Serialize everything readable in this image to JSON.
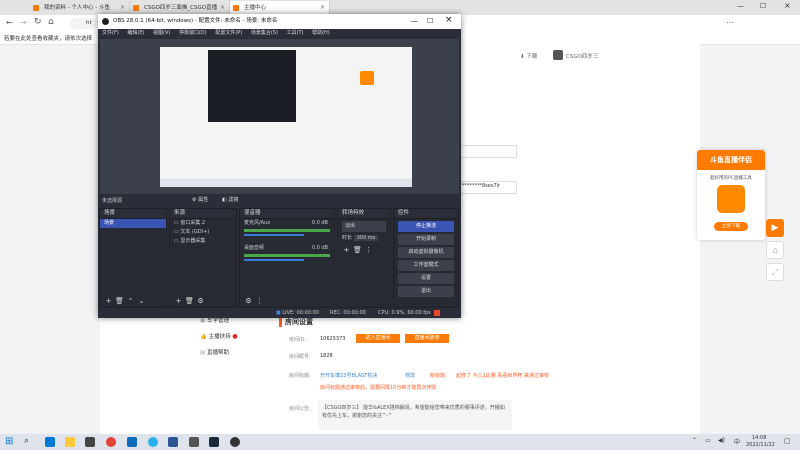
{
  "browser": {
    "tabs": [
      {
        "label": "我的资料 - 个人中心 - 斗鱼",
        "color": "#ff7a00"
      },
      {
        "label": "CSGO四岁三面佛_CSGO直播",
        "color": "#ff7a00"
      },
      {
        "label": "主播中心",
        "color": "#ff7a00"
      }
    ],
    "address_prefix": "ht",
    "notice_text": "若要在此处查看收藏夹，请依次选择",
    "download_label": "下载",
    "user_label": "CSGO四岁三"
  },
  "obs": {
    "title": "OBS 28.0.1 (64-bit, windows) - 配置文件: 未命名 - 场景: 未命名",
    "menu": [
      "文件(F)",
      "编辑(E)",
      "视图(V)",
      "停靠窗口(D)",
      "配置文件(P)",
      "场景集合(S)",
      "工具(T)",
      "帮助(H)"
    ],
    "no_source": "未选择源",
    "properties_btn": "属性",
    "filters_btn": "滤镜",
    "scenes": {
      "title": "场景",
      "items": [
        "场景"
      ]
    },
    "sources": {
      "title": "来源",
      "items": [
        "窗口采集 2",
        "文本 (GDI+)",
        "显示器采集"
      ]
    },
    "mixer": {
      "title": "混音器",
      "tracks": [
        {
          "name": "麦克风/Aux",
          "db": "0.0 dB"
        },
        {
          "name": "桌面音频",
          "db": "0.0 dB"
        }
      ]
    },
    "transitions": {
      "title": "转场特效",
      "type": "淡出",
      "duration_label": "时长",
      "duration": "300 ms"
    },
    "controls": {
      "title": "控件",
      "buttons": [
        "停止推流",
        "开始录制",
        "启动虚拟摄像机",
        "工作室模式",
        "设置",
        "退出"
      ]
    },
    "status": {
      "live": "LIVE: 00:00:00",
      "rec": "REC: 00:00:00",
      "cpu": "CPU: 0.9%, 60.00 fps"
    }
  },
  "page": {
    "menu": [
      "车学管理",
      "主播扶持",
      "直播帮助"
    ],
    "section_title": "房间设置",
    "room_id_label": "房间ID:",
    "room_id": "10625373",
    "enter_room_btn": "进入直播间",
    "modify_room_btn": "直播间装修",
    "room_name_label": "房间昵号:",
    "room_name": "1828",
    "room_title_label": "房间标题:",
    "room_title": "开开车博23号BLAST杭决",
    "modify_link": "修改",
    "hint_label": "新标题:",
    "hint_text": "起修了 今儿1比赛 看看世界杯  来通过审核",
    "hint_line2": "房间标题通过审核后，需要间隔10分钟才能再次修改",
    "notice_label": "房间公告:",
    "notice_text": "【CSGO四岁三】 能华&ALEX搭档解说，希望能给您带来优质的赛事评述，开播如有优先上车，谢谢您的关注^-^",
    "password_partial": "**********8ses7lr"
  },
  "ad": {
    "title": "斗鱼直播伴侣",
    "subtitle": "超好用的PC直播工具",
    "button": "立即下载"
  },
  "taskbar": {
    "time": "14:08",
    "date": "2022/11/22",
    "lang": "中"
  }
}
